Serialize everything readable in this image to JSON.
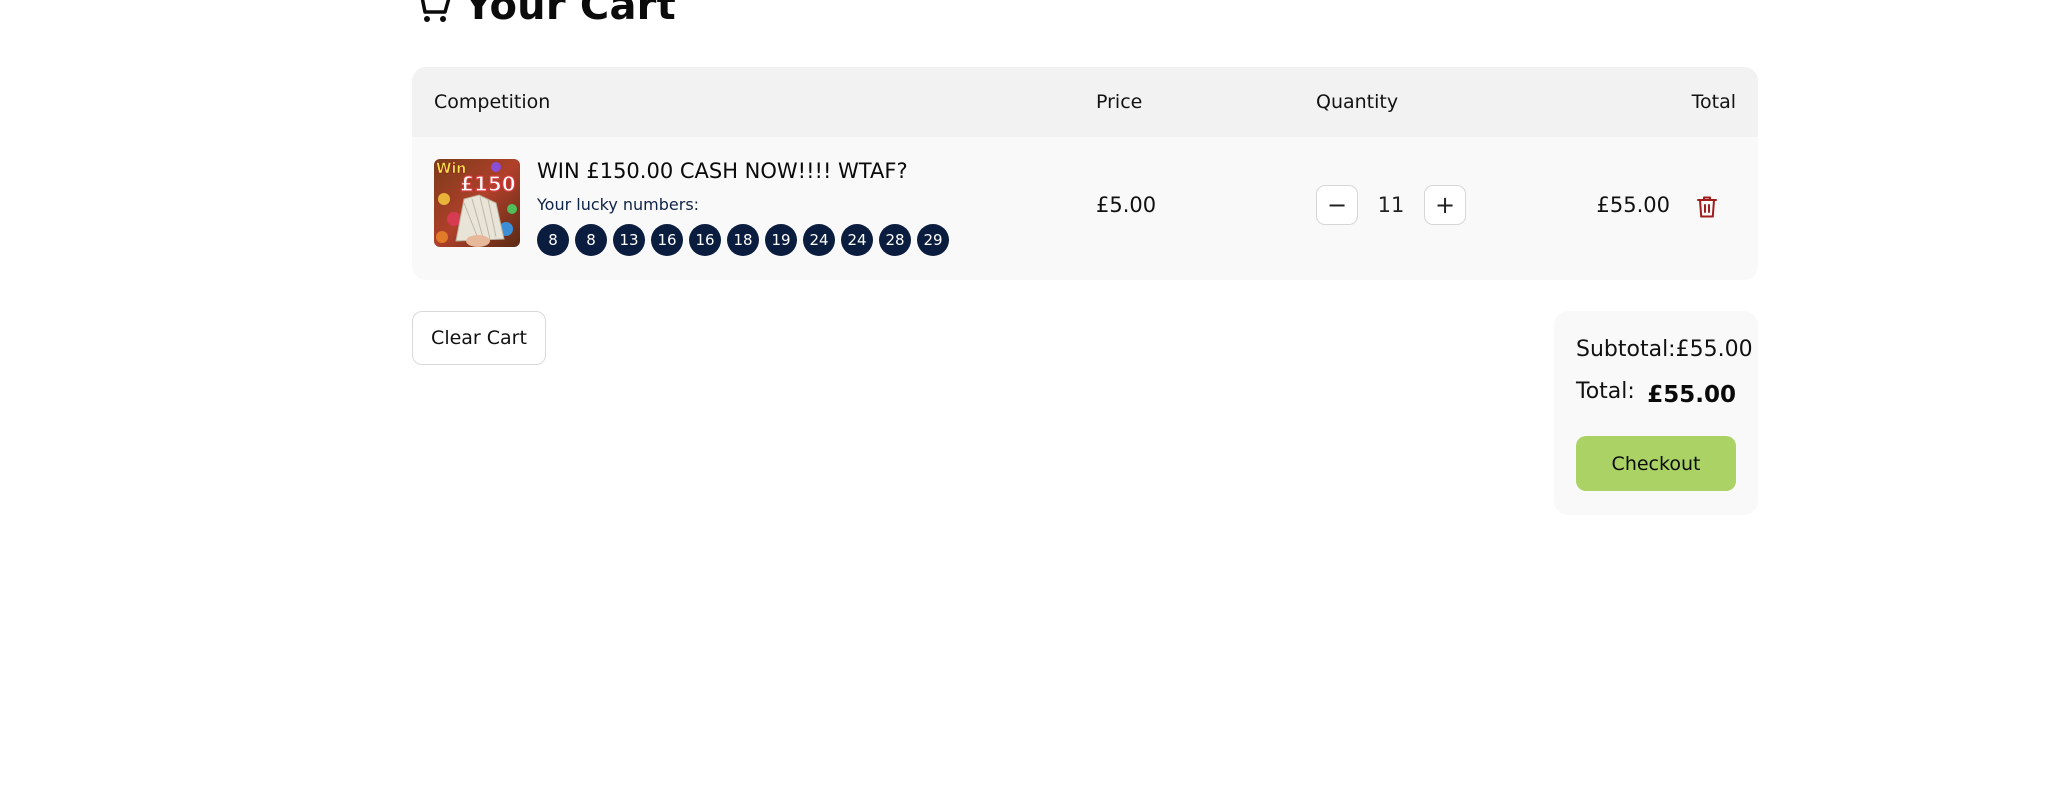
{
  "page": {
    "title": "Your Cart",
    "title_icon": "cart-icon"
  },
  "table": {
    "headers": {
      "competition": "Competition",
      "price": "Price",
      "quantity": "Quantity",
      "total": "Total"
    },
    "rows": [
      {
        "title": "WIN £150.00 CASH NOW!!!! WTAF?",
        "thumb_text_win": "Win",
        "thumb_text_amount": "£150",
        "lucky_label": "Your lucky numbers:",
        "lucky_numbers": [
          "8",
          "8",
          "13",
          "16",
          "16",
          "18",
          "19",
          "24",
          "24",
          "28",
          "29"
        ],
        "price": "£5.00",
        "quantity": "11",
        "decrement": "−",
        "increment": "+",
        "total": "£55.00"
      }
    ]
  },
  "actions": {
    "clear_cart": "Clear Cart"
  },
  "summary": {
    "subtotal_label": "Subtotal:",
    "subtotal_value": "£55.00",
    "total_label": "Total:",
    "total_value": "£55.00",
    "checkout": "Checkout"
  },
  "colors": {
    "ball_bg": "#0b1d3f",
    "checkout_bg": "#aad265",
    "trash": "#a11d1d",
    "table_head_bg": "#f2f2f2"
  }
}
